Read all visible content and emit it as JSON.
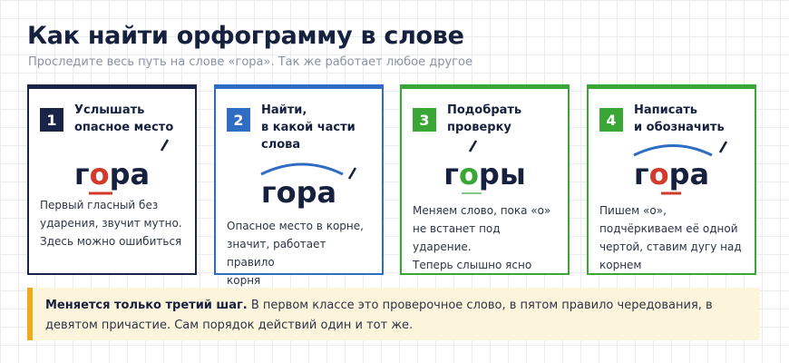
{
  "title": "Как найти орфограмму в слове",
  "subtitle": "Проследите весь путь на слове «гора». Так же работает любое другое",
  "colors": {
    "navy": "#1a2448",
    "blue": "#2f6cc4",
    "green": "#3aa635",
    "red": "#d23a2b",
    "accent_yellow": "#f2a81d"
  },
  "steps": [
    {
      "number": "1",
      "heading": [
        "Услышать",
        "опасное место"
      ],
      "word": [
        "г",
        "о",
        "ра"
      ],
      "description": [
        "Первый гласный без",
        "ударения, звучит мутно.",
        "Здесь можно ошибиться"
      ]
    },
    {
      "number": "2",
      "heading": [
        "Найти,",
        "в какой части",
        "слова"
      ],
      "word": [
        "гора"
      ],
      "description": [
        "Опасное место в корне,",
        "значит, работает правило",
        "корня"
      ]
    },
    {
      "number": "3",
      "heading": [
        "Подобрать",
        "проверку"
      ],
      "word": [
        "г",
        "о",
        "ры"
      ],
      "description": [
        "Меняем слово, пока «о»",
        "не встанет под ударение.",
        "Теперь слышно ясно"
      ]
    },
    {
      "number": "4",
      "heading": [
        "Написать",
        "и обозначить"
      ],
      "word": [
        "г",
        "о",
        "ра"
      ],
      "description": [
        "Пишем «о»,",
        "подчёркиваем её одной",
        "чертой, ставим дугу над",
        "корнем"
      ]
    }
  ],
  "note": {
    "bold": "Меняется только третий шаг.",
    "text": " В первом классе это проверочное слово, в пятом правило чередования, в девятом причастие. Сам порядок действий один и тот же."
  }
}
